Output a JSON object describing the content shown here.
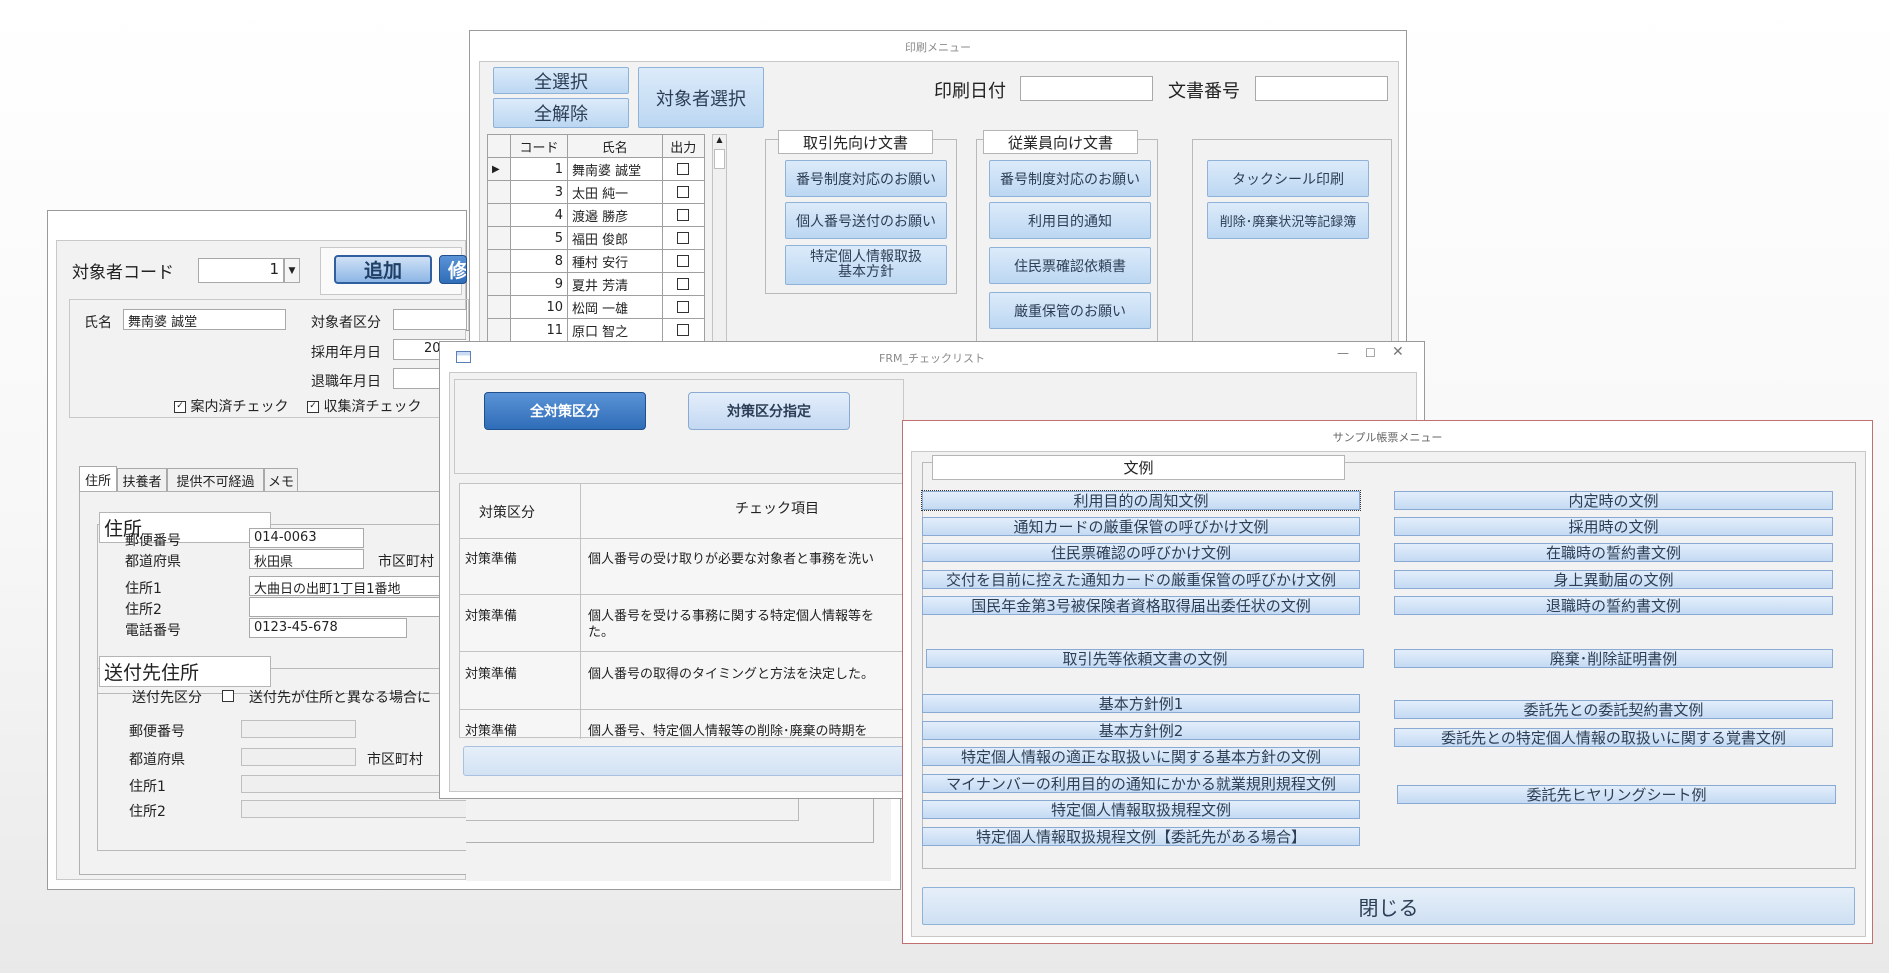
{
  "subject_window": {
    "code_label": "対象者コード",
    "code_value": "1",
    "add_button": "追加",
    "edit_button_partial": "修",
    "name_label": "氏名",
    "name_value": "舞南婆  誠堂",
    "category_label": "対象者区分",
    "hire_date_label": "採用年月日",
    "hire_date_value_partial": "20",
    "retire_date_label": "退職年月日",
    "notice_check_label": "案内済チェック",
    "collect_check_label": "収集済チェック",
    "tabs": [
      "住所",
      "扶養者",
      "提供不可経過",
      "メモ"
    ],
    "address_section": "住所",
    "postal_label": "郵便番号",
    "postal_value": "014-0063",
    "pref_label": "都道府県",
    "pref_value": "秋田県",
    "city_label": "市区町村",
    "addr1_label": "住所1",
    "addr1_value": "大曲日の出町1丁目1番地",
    "addr2_label": "住所2",
    "phone_label": "電話番号",
    "phone_value": "0123-45-678",
    "send_section": "送付先住所",
    "send_category_label": "送付先区分",
    "send_note_partial": "送付先が住所と異なる場合に",
    "send_postal_label": "郵便番号",
    "send_pref_label": "都道府県",
    "send_city_label": "市区町村",
    "send_addr1_label": "住所1",
    "send_addr2_label": "住所2"
  },
  "print_menu": {
    "title": "印刷メニュー",
    "select_all": "全選択",
    "deselect_all": "全解除",
    "target_select": "対象者選択",
    "print_date_label": "印刷日付",
    "doc_number_label": "文書番号",
    "grid_headers": [
      "コード",
      "氏名",
      "出力"
    ],
    "rows": [
      {
        "code": "1",
        "name": "舞南婆  誠堂"
      },
      {
        "code": "3",
        "name": "太田  純一"
      },
      {
        "code": "4",
        "name": "渡邉  勝彦"
      },
      {
        "code": "5",
        "name": "福田  俊郎"
      },
      {
        "code": "8",
        "name": "種村  安行"
      },
      {
        "code": "9",
        "name": "夏井  芳清"
      },
      {
        "code": "10",
        "name": "松岡  一雄"
      },
      {
        "code": "11",
        "name": "原口  智之"
      }
    ],
    "client_group_title": "取引先向け文書",
    "client_buttons": [
      "番号制度対応のお願い",
      "個人番号送付のお願い",
      "特定個人情報取扱\n基本方針"
    ],
    "employee_group_title": "従業員向け文書",
    "employee_buttons": [
      "番号制度対応のお願い",
      "利用目的通知",
      "住民票確認依頼書",
      "厳重保管のお願い"
    ],
    "other_buttons": [
      "タックシール印刷",
      "削除･廃棄状況等記録簿"
    ]
  },
  "checklist": {
    "title": "FRM_チェックリスト",
    "btn_all": "全対策区分",
    "btn_specify": "対策区分指定",
    "col_category": "対策区分",
    "col_item": "チェック項目",
    "rows": [
      {
        "category": "対策準備",
        "item": "個人番号の受け取りが必要な対象者と事務を洗い"
      },
      {
        "category": "対策準備",
        "item": "個人番号を受ける事務に関する特定個人情報等を",
        "item2": "た。"
      },
      {
        "category": "対策準備",
        "item": "個人番号の取得のタイミングと方法を決定した。"
      },
      {
        "category": "対策準備",
        "item": "個人番号、特定個人情報等の削除･廃棄の時期を"
      }
    ]
  },
  "sample_menu": {
    "title": "サンプル帳票メニュー",
    "group_title": "文例",
    "left_items": [
      "利用目的の周知文例",
      "通知カードの厳重保管の呼びかけ文例",
      "住民票確認の呼びかけ文例",
      "交付を目前に控えた通知カードの厳重保管の呼びかけ文例",
      "国民年金第3号被保険者資格取得届出委任状の文例",
      "取引先等依頼文書の文例",
      "基本方針例1",
      "基本方針例2",
      "特定個人情報の適正な取扱いに関する基本方針の文例",
      "マイナンバーの利用目的の通知にかかる就業規則規程文例",
      "特定個人情報取扱規程文例",
      "特定個人情報取扱規程文例【委託先がある場合】"
    ],
    "right_items": [
      "内定時の文例",
      "採用時の文例",
      "在職時の誓約書文例",
      "身上異動届の文例",
      "退職時の誓約書文例",
      "廃棄･削除証明書例",
      "委託先との委託契約書文例",
      "委託先との特定個人情報の取扱いに関する覚書文例",
      "委託先ヒヤリングシート例"
    ],
    "close_button": "閉じる"
  }
}
